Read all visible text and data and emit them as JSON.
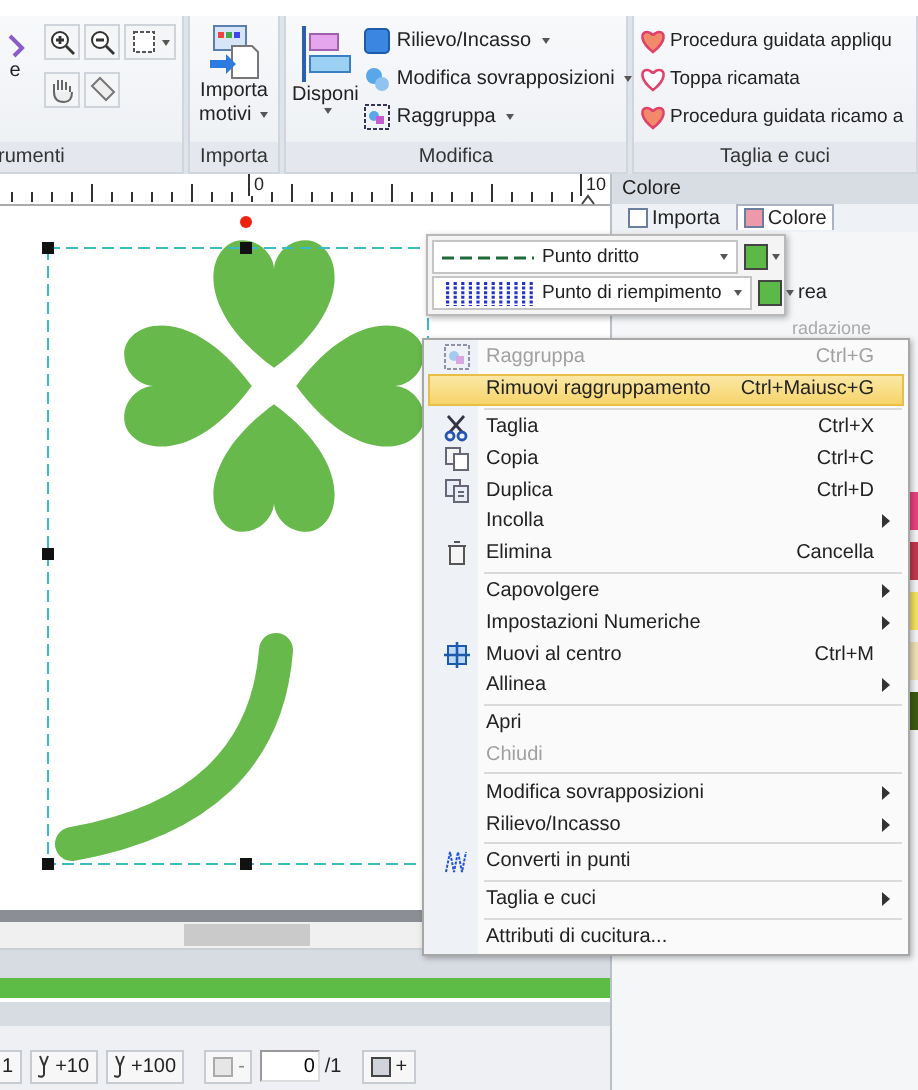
{
  "ribbon": {
    "groups": [
      {
        "kind": "tools",
        "label": "rumenti",
        "items": [
          "e"
        ]
      },
      {
        "kind": "import",
        "label": "Importa",
        "items": [
          "Importa",
          "motivi"
        ]
      },
      {
        "kind": "edit",
        "label": "Modifica",
        "items": [
          "Disponi",
          "Rilievo/Incasso",
          "Modifica sovrapposizioni",
          "Raggruppa"
        ]
      },
      {
        "kind": "cut",
        "label": "Taglia e cuci",
        "items": [
          "Procedura guidata appliqu",
          "Toppa ricamata",
          "Procedura guidata ricamo a"
        ]
      }
    ]
  },
  "ruler": {
    "labels": [
      "0",
      "10"
    ]
  },
  "side_panel": {
    "title": "Colore",
    "tabs": [
      {
        "label": "Importa",
        "selected": false
      },
      {
        "label": "Colore",
        "selected": true
      }
    ],
    "texts": [
      "rea",
      "radazione"
    ],
    "swatches": [
      {
        "color": "#e8417e"
      },
      {
        "color": "#c2384e"
      },
      {
        "color": "#f5e35f"
      },
      {
        "color": "#efe2b5"
      },
      {
        "color": "#3f5a12"
      }
    ]
  },
  "stitch_toolbar": {
    "rows": [
      {
        "kind": "line",
        "label": "Punto dritto",
        "color": "#5cb947"
      },
      {
        "kind": "fill",
        "label": "Punto di riempimento",
        "color": "#5cb947"
      }
    ]
  },
  "context_menu": {
    "groups": [
      [
        {
          "label": "Raggruppa",
          "shortcut": "Ctrl+G",
          "kind": "group",
          "disabled": true,
          "submenu": false,
          "selected": false
        },
        {
          "label": "Rimuovi raggruppamento",
          "shortcut": "Ctrl+Maiusc+G",
          "kind": "plain",
          "disabled": false,
          "submenu": false,
          "selected": true
        }
      ],
      [
        {
          "label": "Taglia",
          "shortcut": "Ctrl+X",
          "kind": "cut",
          "disabled": false,
          "submenu": false,
          "selected": false
        },
        {
          "label": "Copia",
          "shortcut": "Ctrl+C",
          "kind": "copy",
          "disabled": false,
          "submenu": false,
          "selected": false
        },
        {
          "label": "Duplica",
          "shortcut": "Ctrl+D",
          "kind": "duplicate",
          "disabled": false,
          "submenu": false,
          "selected": false
        },
        {
          "label": "Incolla",
          "kind": "plain",
          "disabled": false,
          "submenu": true,
          "selected": false
        },
        {
          "label": "Elimina",
          "shortcut": "Cancella",
          "kind": "delete",
          "disabled": false,
          "submenu": false,
          "selected": false
        }
      ],
      [
        {
          "label": "Capovolgere",
          "kind": "plain",
          "disabled": false,
          "submenu": true,
          "selected": false
        },
        {
          "label": "Impostazioni Numeriche",
          "kind": "plain",
          "disabled": false,
          "submenu": true,
          "selected": false
        },
        {
          "label": "Muovi al centro",
          "shortcut": "Ctrl+M",
          "kind": "center",
          "disabled": false,
          "submenu": false,
          "selected": false
        },
        {
          "label": "Allinea",
          "kind": "plain",
          "disabled": false,
          "submenu": true,
          "selected": false
        }
      ],
      [
        {
          "label": "Apri",
          "kind": "plain",
          "disabled": false,
          "submenu": false,
          "selected": false
        },
        {
          "label": "Chiudi",
          "kind": "plain",
          "disabled": true,
          "submenu": false,
          "selected": false
        }
      ],
      [
        {
          "label": "Modifica sovrapposizioni",
          "kind": "plain",
          "disabled": false,
          "submenu": true,
          "selected": false
        },
        {
          "label": "Rilievo/Incasso",
          "kind": "plain",
          "disabled": false,
          "submenu": true,
          "selected": false
        }
      ],
      [
        {
          "label": "Converti in punti",
          "kind": "stitch",
          "disabled": false,
          "submenu": false,
          "selected": false
        }
      ],
      [
        {
          "label": "Taglia e cuci",
          "kind": "plain",
          "disabled": false,
          "submenu": true,
          "selected": false
        }
      ],
      [
        {
          "label": "Attributi di cucitura...",
          "kind": "plain",
          "disabled": false,
          "submenu": false,
          "selected": false
        }
      ]
    ]
  },
  "progress": {
    "level": 1
  },
  "bottom_toolbar": {
    "buttons": [
      "1",
      "+10",
      "+100"
    ],
    "frame_prev": "-",
    "frame_value": "0",
    "frame_total": "/1",
    "frame_next": "+"
  }
}
